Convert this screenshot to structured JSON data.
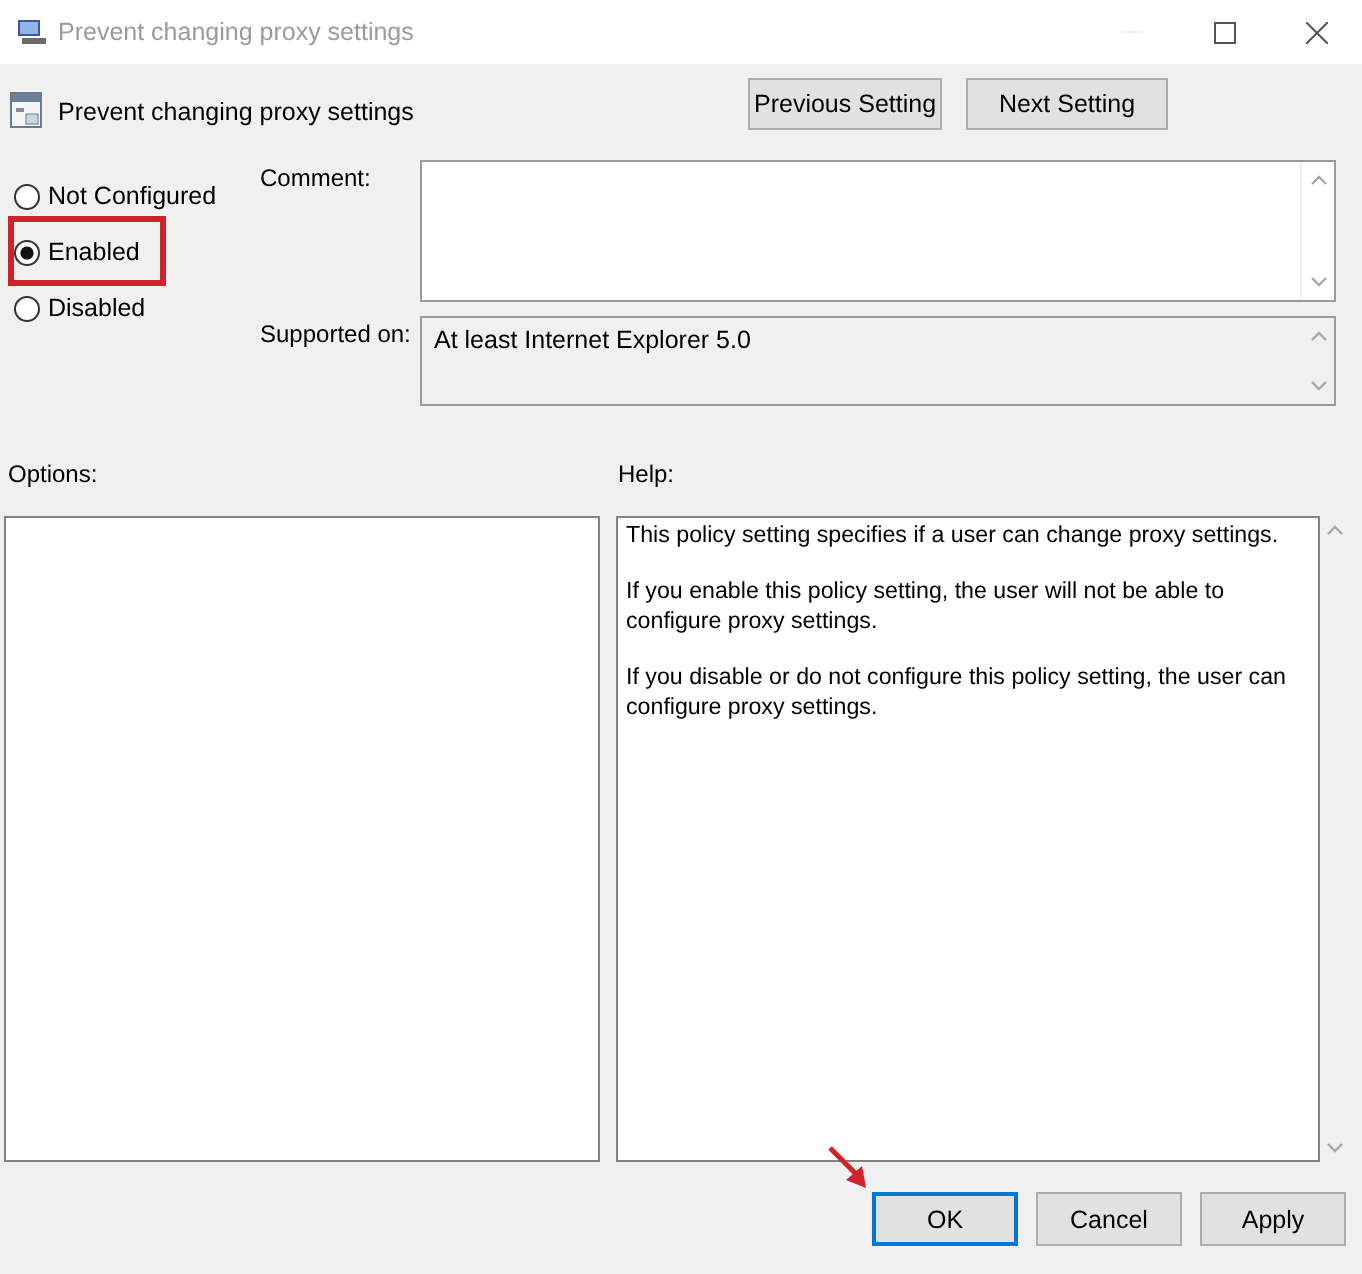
{
  "window": {
    "title": "Prevent changing proxy settings"
  },
  "policy": {
    "title": "Prevent changing proxy settings"
  },
  "nav_buttons": [
    "Previous Setting",
    "Next Setting"
  ],
  "state_options": [
    {
      "label": "Not Configured",
      "selected": false,
      "highlighted": false
    },
    {
      "label": "Enabled",
      "selected": true,
      "highlighted": true
    },
    {
      "label": "Disabled",
      "selected": false,
      "highlighted": false
    }
  ],
  "comment": {
    "label": "Comment:"
  },
  "supported_on": {
    "label": "Supported on:",
    "value": "At least Internet Explorer 5.0"
  },
  "options": {
    "label": "Options:"
  },
  "help": {
    "label": "Help:",
    "paragraphs": [
      "This policy setting specifies if a user can change proxy settings.",
      "If you enable this policy setting, the user will not be able to configure proxy settings.",
      "If you disable or do not configure this policy setting, the user can configure proxy settings."
    ]
  },
  "buttons": [
    {
      "label": "OK",
      "default": true,
      "pointed": true
    },
    {
      "label": "Cancel",
      "default": false,
      "pointed": false
    },
    {
      "label": "Apply",
      "default": false,
      "pointed": false
    }
  ]
}
